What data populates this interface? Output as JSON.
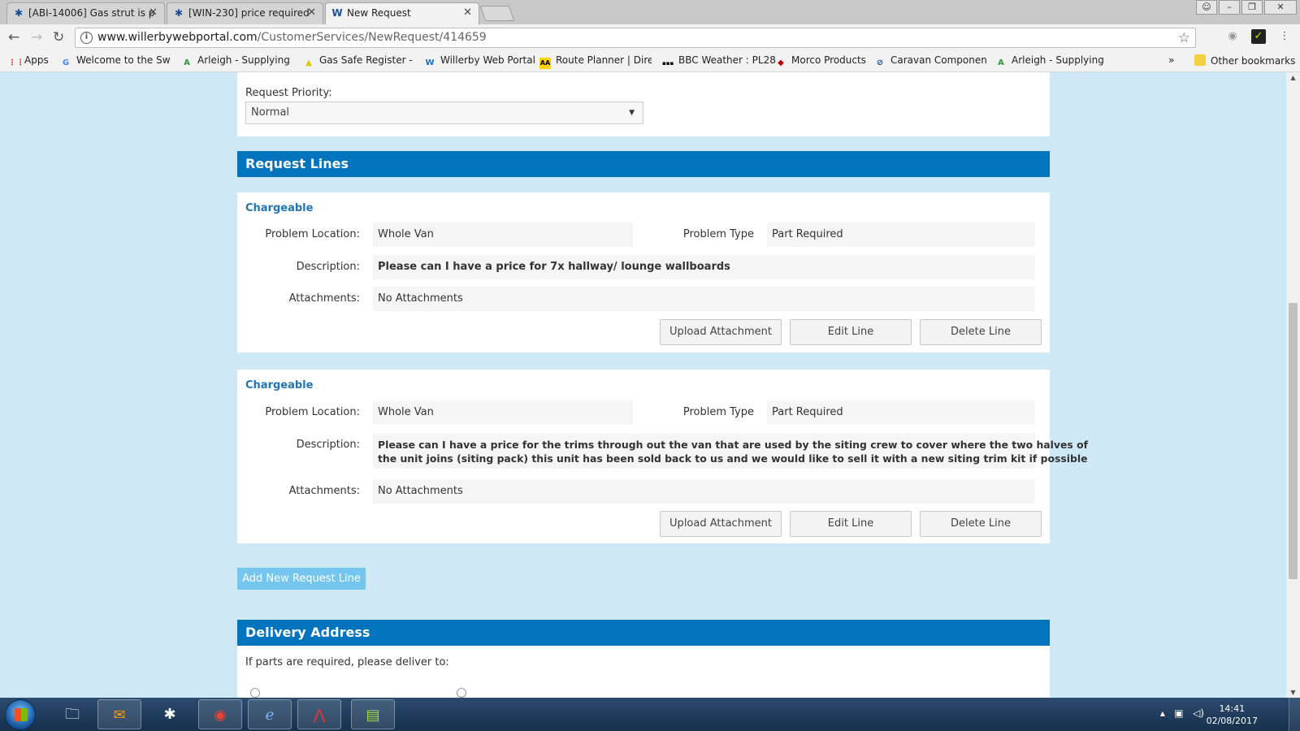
{
  "browser": {
    "tabs": [
      {
        "label": "[ABI-14006] Gas strut is p",
        "icon": "jira-icon"
      },
      {
        "label": "[WIN-230] price required",
        "icon": "jira-icon"
      },
      {
        "label": "New Request",
        "icon": "willerby-icon"
      }
    ],
    "url_host": "www.willerbywebportal.com",
    "url_path": "/CustomerServices/NewRequest/414659",
    "bookmarks": [
      {
        "label": "Apps",
        "icon": "apps-grid-icon"
      },
      {
        "label": "Welcome to the Swift",
        "icon": "google-icon"
      },
      {
        "label": "Arleigh - Supplying t",
        "icon": "arleigh-icon"
      },
      {
        "label": "Gas Safe Register - Lo",
        "icon": "gassafe-icon"
      },
      {
        "label": "Willerby Web Portal",
        "icon": "willerby-icon"
      },
      {
        "label": "Route Planner | Direc",
        "icon": "aa-icon"
      },
      {
        "label": "BBC Weather : PL28",
        "icon": "bbc-icon"
      },
      {
        "label": "Morco Products",
        "icon": "morco-icon"
      },
      {
        "label": "Caravan Components",
        "icon": "caravan-icon"
      },
      {
        "label": "Arleigh - Supplying t",
        "icon": "arleigh-icon"
      }
    ],
    "more_bookmarks": "»",
    "other_bookmarks": "Other bookmarks"
  },
  "priority": {
    "label": "Request Priority:",
    "value": "Normal"
  },
  "request_lines": {
    "header": "Request Lines",
    "lines": [
      {
        "title": "Chargeable",
        "problem_location_label": "Problem Location:",
        "problem_location": "Whole Van",
        "problem_type_label": "Problem Type",
        "problem_type": "Part Required",
        "description_label": "Description:",
        "description": "Please can I have a price for 7x hallway/ lounge wallboards",
        "attachments_label": "Attachments:",
        "attachments": "No Attachments",
        "upload_label": "Upload Attachment",
        "edit_label": "Edit Line",
        "delete_label": "Delete Line"
      },
      {
        "title": "Chargeable",
        "problem_location_label": "Problem Location:",
        "problem_location": "Whole Van",
        "problem_type_label": "Problem Type",
        "problem_type": "Part Required",
        "description_label": "Description:",
        "description_line1": "Please can I have a price for the trims through out the van that are used by the siting crew to cover where the two halves of",
        "description_line2": "the unit joins (siting pack) this unit has been sold back to us and we would like to sell it with a new siting trim kit if possible",
        "attachments_label": "Attachments:",
        "attachments": "No Attachments",
        "upload_label": "Upload Attachment",
        "edit_label": "Edit Line",
        "delete_label": "Delete Line"
      }
    ],
    "add_label": "Add New Request Line"
  },
  "delivery": {
    "header": "Delivery Address",
    "prompt": "If parts are required, please deliver to:"
  },
  "taskbar": {
    "time": "14:41",
    "date": "02/08/2017"
  }
}
